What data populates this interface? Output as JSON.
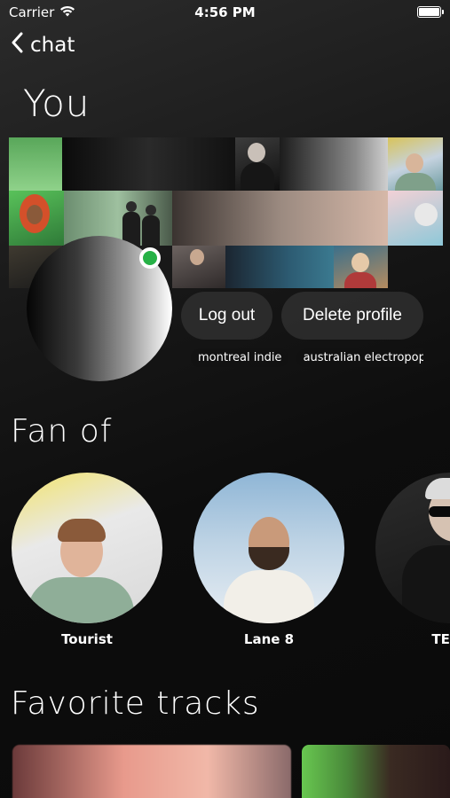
{
  "status_bar": {
    "carrier": "Carrier",
    "time": "4:56 PM",
    "icons": [
      "wifi-icon",
      "battery-icon"
    ]
  },
  "nav": {
    "back_label": "chat"
  },
  "profile": {
    "title": "You",
    "online": true,
    "logout_label": "Log out",
    "delete_label": "Delete profile",
    "genres": [
      "montreal indie",
      "australian electropop"
    ]
  },
  "fan_of": {
    "title": "Fan of",
    "artists": [
      {
        "name": "Tourist"
      },
      {
        "name": "Lane 8"
      },
      {
        "name": "TEED"
      }
    ]
  },
  "favorite_tracks": {
    "title": "Favorite tracks"
  },
  "colors": {
    "background": "#0c0c0c",
    "button_bg": "#2d2d2d",
    "online_green": "#26b146",
    "text": "#ffffff"
  }
}
